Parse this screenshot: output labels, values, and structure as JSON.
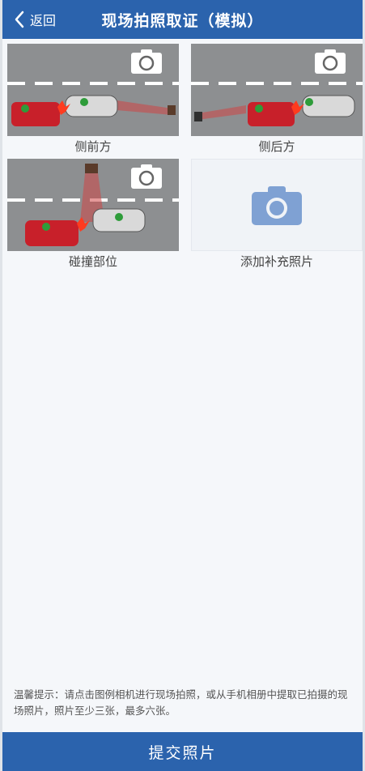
{
  "header": {
    "back_label": "返回",
    "title": "现场拍照取证（模拟）"
  },
  "photos": [
    {
      "label": "侧前方",
      "icon": "camera-icon"
    },
    {
      "label": "侧后方",
      "icon": "camera-icon"
    },
    {
      "label": "碰撞部位",
      "icon": "camera-icon"
    }
  ],
  "add_photo": {
    "label": "添加补充照片",
    "icon": "camera-icon"
  },
  "hint": "温馨提示：请点击图例相机进行现场拍照，或从手机相册中提取已拍摄的现场照片，照片至少三张，最多六张。",
  "submit_label": "提交照片",
  "colors": {
    "brand": "#2b63ad",
    "add_camera": "#7fa1d3",
    "road": "#8d8f91",
    "car_b": "#c8202a",
    "car_a": "#d9d9d9"
  }
}
